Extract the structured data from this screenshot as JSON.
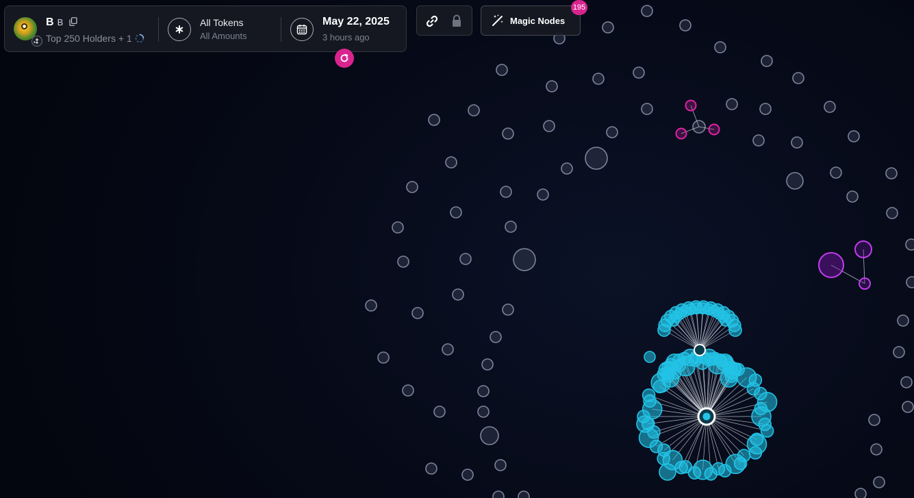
{
  "token": {
    "name": "B",
    "symbol": "B",
    "holders_label": "Top 250 Holders + 1",
    "avatar_icon": "frog-avatar-icon",
    "chain_icon": "bnb-chain-icon"
  },
  "filter": {
    "title": "All Tokens",
    "subtitle": "All Amounts",
    "icon": "asterisk-icon"
  },
  "date": {
    "title": "May 22, 2025",
    "subtitle": "3 hours ago",
    "icon": "calendar-icon"
  },
  "toolbar": {
    "link_icon": "link-icon",
    "lock_icon": "lock-icon",
    "magic_label": "Magic Nodes",
    "magic_count": "195",
    "magic_icon": "magic-wand-icon"
  },
  "colors": {
    "node_grey": "#7d859c",
    "node_cyan": "#22c3e6",
    "node_magenta": "#e022a6",
    "node_purple": "#c43cf0",
    "accent": "#d9248f",
    "background": "#050814"
  }
}
